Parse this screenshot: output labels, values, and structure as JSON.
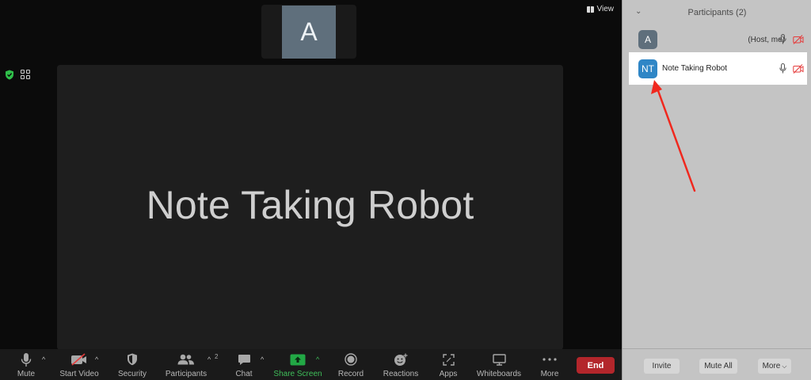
{
  "meeting": {
    "view_label": "View",
    "thumbnail_initial": "A",
    "active_speaker_name": "Note Taking Robot"
  },
  "toolbar": {
    "mute": "Mute",
    "start_video": "Start Video",
    "security": "Security",
    "participants": "Participants",
    "participants_count": "2",
    "chat": "Chat",
    "share_screen": "Share Screen",
    "record": "Record",
    "reactions": "Reactions",
    "apps": "Apps",
    "whiteboards": "Whiteboards",
    "more": "More",
    "end": "End"
  },
  "panel": {
    "title": "Participants (2)",
    "participants": [
      {
        "initials": "A",
        "name": "",
        "status": "(Host, me)",
        "avatar_color": "#5f6f7c"
      },
      {
        "initials": "NT",
        "name": "Note Taking Robot",
        "status": "",
        "avatar_color": "#2f86c6"
      }
    ],
    "footer": {
      "invite": "Invite",
      "mute_all": "Mute All",
      "more": "More"
    }
  },
  "colors": {
    "share_green": "#22a845",
    "end_red": "#b3262b",
    "annotation_red": "#f0281e",
    "secure_green": "#2fbf4a"
  }
}
